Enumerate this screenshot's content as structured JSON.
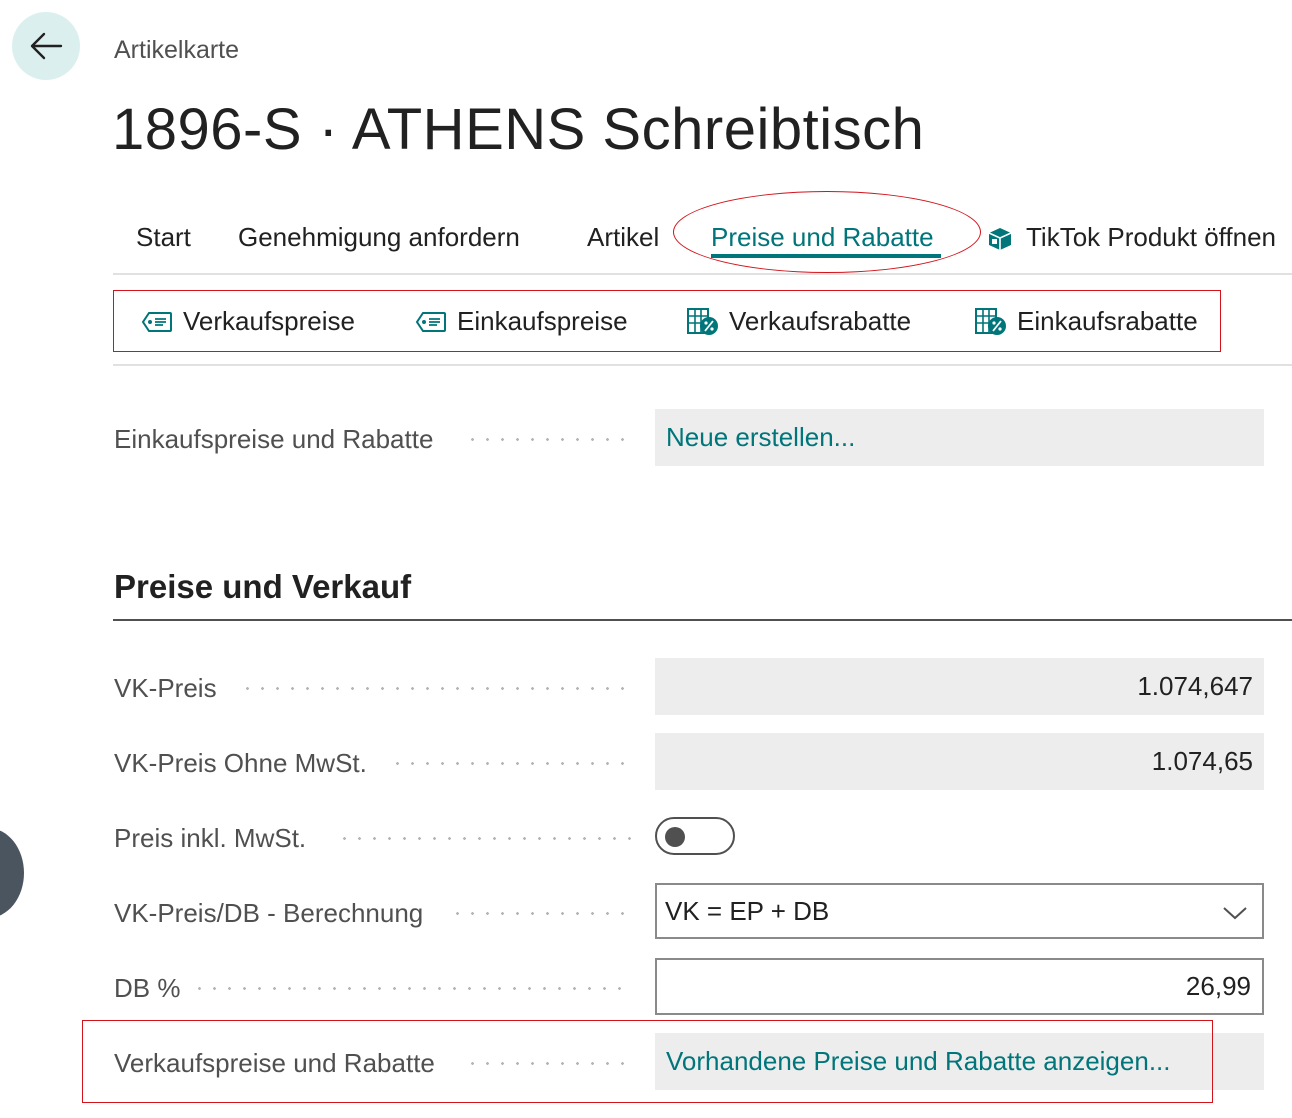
{
  "header": {
    "breadcrumb": "Artikelkarte",
    "title": "1896-S · ATHENS Schreibtisch"
  },
  "tabs": [
    {
      "label": "Start"
    },
    {
      "label": "Genehmigung anfordern"
    },
    {
      "label": "Artikel"
    },
    {
      "label": "Preise und Rabatte",
      "active": true
    },
    {
      "label": "TikTok Produkt öffnen",
      "icon": "box-icon"
    }
  ],
  "actions": [
    {
      "label": "Verkaufspreise",
      "icon": "price-tag-icon"
    },
    {
      "label": "Einkaufspreise",
      "icon": "price-tag-icon"
    },
    {
      "label": "Verkaufsrabatte",
      "icon": "discount-grid-icon"
    },
    {
      "label": "Einkaufsrabatte",
      "icon": "discount-grid-icon"
    }
  ],
  "purchase": {
    "label": "Einkaufspreise und Rabatte",
    "link": "Neue erstellen..."
  },
  "section": {
    "title": "Preise und Verkauf",
    "fields": {
      "vk_preis": {
        "label": "VK-Preis",
        "value": "1.074,647"
      },
      "vk_preis_ohne_mwst": {
        "label": "VK-Preis Ohne MwSt.",
        "value": "1.074,65"
      },
      "preis_inkl_mwst": {
        "label": "Preis inkl. MwSt.",
        "value": false
      },
      "berechnung": {
        "label": "VK-Preis/DB - Berechnung",
        "value": "VK = EP + DB"
      },
      "db_prozent": {
        "label": "DB %",
        "value": "26,99"
      },
      "verkaufspreise_rabatte": {
        "label": "Verkaufspreise und Rabatte",
        "link": "Vorhandene Preise und Rabatte anzeigen..."
      }
    }
  },
  "colors": {
    "accent": "#00757a",
    "highlight_annotation": "#d1141b",
    "back_button_bg": "#dcefef"
  }
}
